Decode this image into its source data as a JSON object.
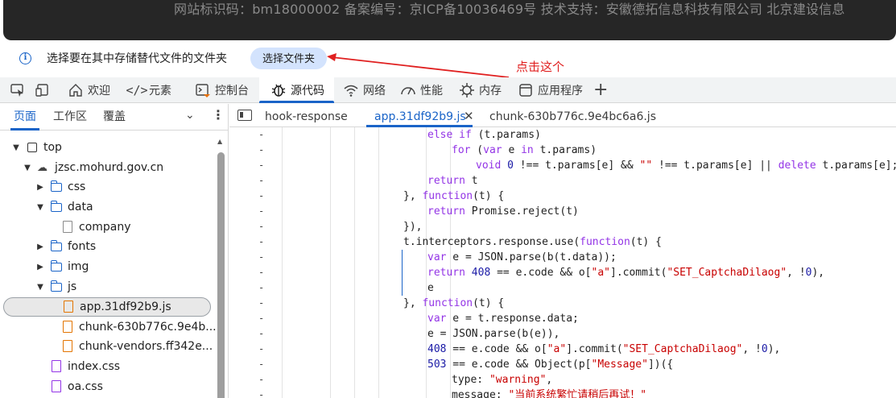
{
  "site_footer": {
    "text": "网站标识码：bm18000002   备案编号：京ICP备10036469号   技术支持：安徽德拓信息科技有限公司 北京建设信息"
  },
  "infobar": {
    "message": "选择要在其中存储替代文件的文件夹",
    "button_label": "选择文件夹",
    "annotation": "点击这个",
    "annotation_color": "#e02020"
  },
  "devtools_tabs": [
    {
      "label": "",
      "icon": "inspect-icon"
    },
    {
      "label": "",
      "icon": "device-icon"
    },
    {
      "label": "欢迎",
      "icon": "home-icon"
    },
    {
      "label": "元素",
      "icon": "code-icon"
    },
    {
      "label": "控制台",
      "icon": "console-icon"
    },
    {
      "label": "源代码",
      "icon": "bug-icon",
      "active": true
    },
    {
      "label": "网络",
      "icon": "wifi-icon"
    },
    {
      "label": "性能",
      "icon": "performance-icon"
    },
    {
      "label": "内存",
      "icon": "memory-icon"
    },
    {
      "label": "应用程序",
      "icon": "application-icon"
    }
  ],
  "navigator": {
    "tabs": [
      "页面",
      "工作区",
      "覆盖"
    ],
    "tree": [
      {
        "label": "top",
        "icon": "frame-icon",
        "level": 0,
        "expanded": true
      },
      {
        "label": "jzsc.mohurd.gov.cn",
        "icon": "cloud-icon",
        "level": 1,
        "expanded": true
      },
      {
        "label": "css",
        "icon": "folder-icon",
        "level": 2,
        "expanded": false
      },
      {
        "label": "data",
        "icon": "folder-icon",
        "level": 2,
        "expanded": true
      },
      {
        "label": "company",
        "icon": "file-icon",
        "level": 3
      },
      {
        "label": "fonts",
        "icon": "folder-icon",
        "level": 2,
        "expanded": false
      },
      {
        "label": "img",
        "icon": "folder-icon",
        "level": 2,
        "expanded": false
      },
      {
        "label": "js",
        "icon": "folder-icon",
        "level": 2,
        "expanded": true
      },
      {
        "label": "app.31df92b9.js",
        "icon": "js-file-icon",
        "level": 3,
        "selected": true
      },
      {
        "label": "chunk-630b776c.9e4b...",
        "icon": "js-file-icon",
        "level": 3
      },
      {
        "label": "chunk-vendors.ff342e...",
        "icon": "js-file-icon",
        "level": 3
      },
      {
        "label": "index.css",
        "icon": "css-file-icon",
        "level": 2
      },
      {
        "label": "oa.css",
        "icon": "css-file-icon",
        "level": 2
      }
    ]
  },
  "editor": {
    "tabs": [
      {
        "label": "hook-response"
      },
      {
        "label": "app.31df92b9.js",
        "active": true
      },
      {
        "label": "chunk-630b776c.9e4bc6a6.js"
      }
    ],
    "lines": [
      "else if (t.params)",
      "for (var e in t.params)",
      "void 0 !== t.params[e] && \"\" !== t.params[e] || delete t.params[e];",
      "return t",
      "}, function(t) {",
      "return Promise.reject(t)",
      "}),",
      "t.interceptors.response.use(function(t) {",
      "var e = JSON.parse(b(t.data));",
      "return 408 == e.code && o[\"a\"].commit(\"SET_CaptchaDilaog\", !0),",
      "e",
      "}, function(t) {",
      "var e = t.response.data;",
      "e = JSON.parse(b(e)),",
      "408 == e.code && o[\"a\"].commit(\"SET_CaptchaDilaog\", !0),",
      "503 == e.code && Object(p[\"Message\"])({",
      "type: \"warning\",",
      "message: \"当前系统繁忙请稍后再试！\""
    ]
  }
}
